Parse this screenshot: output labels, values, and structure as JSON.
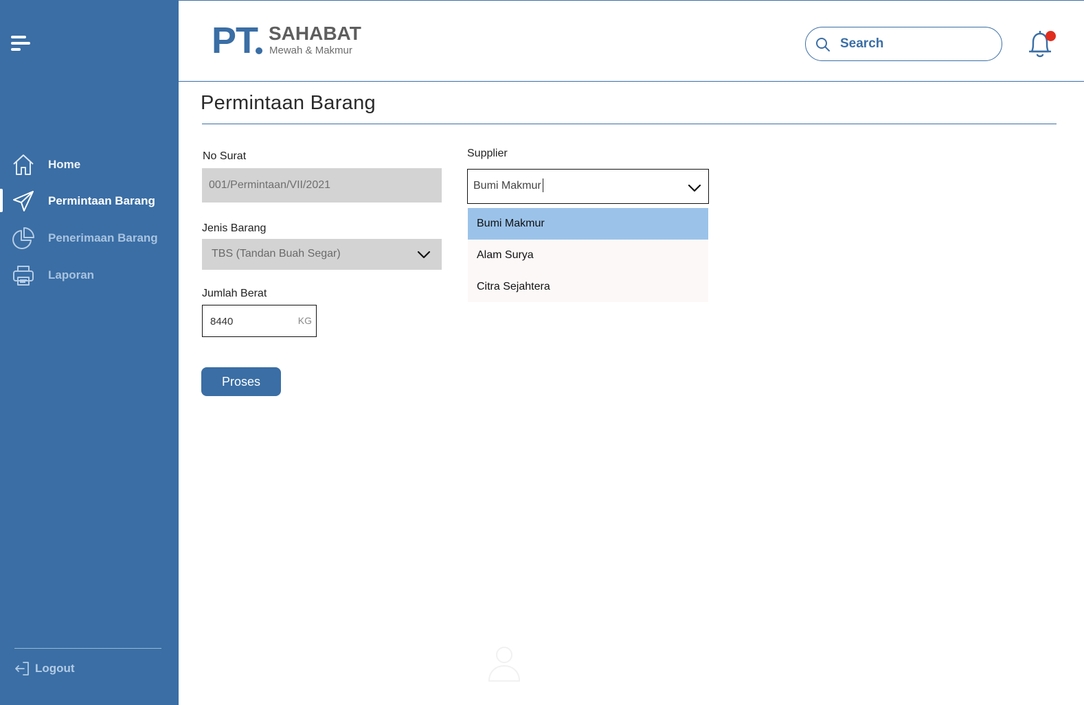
{
  "brand": {
    "pt": "PT",
    "name": "SAHABAT",
    "tagline": "Mewah & Makmur",
    "accent_color": "#3a6ea5"
  },
  "header": {
    "search_placeholder": "Search",
    "notification_badge_color": "#e02d1d"
  },
  "sidebar": {
    "items": [
      {
        "label": "Home",
        "icon": "home-icon",
        "active": false
      },
      {
        "label": "Permintaan Barang",
        "icon": "send-icon",
        "active": true
      },
      {
        "label": "Penerimaan Barang",
        "icon": "pie-chart-icon",
        "active": false
      },
      {
        "label": "Laporan",
        "icon": "printer-icon",
        "active": false
      }
    ],
    "logout_label": "Logout"
  },
  "page": {
    "title": "Permintaan Barang"
  },
  "form": {
    "no_surat": {
      "label": "No Surat",
      "value": "001/Permintaan/VII/2021"
    },
    "jenis_barang": {
      "label": "Jenis Barang",
      "value": "TBS (Tandan Buah Segar)"
    },
    "jumlah_berat": {
      "label": "Jumlah Berat",
      "value": "8440",
      "unit": "KG"
    },
    "supplier": {
      "label": "Supplier",
      "value": "Bumi Makmur",
      "options": [
        "Bumi Makmur",
        "Alam Surya",
        "Citra Sejahtera"
      ],
      "highlighted_option": "Bumi Makmur"
    },
    "submit_label": "Proses"
  }
}
